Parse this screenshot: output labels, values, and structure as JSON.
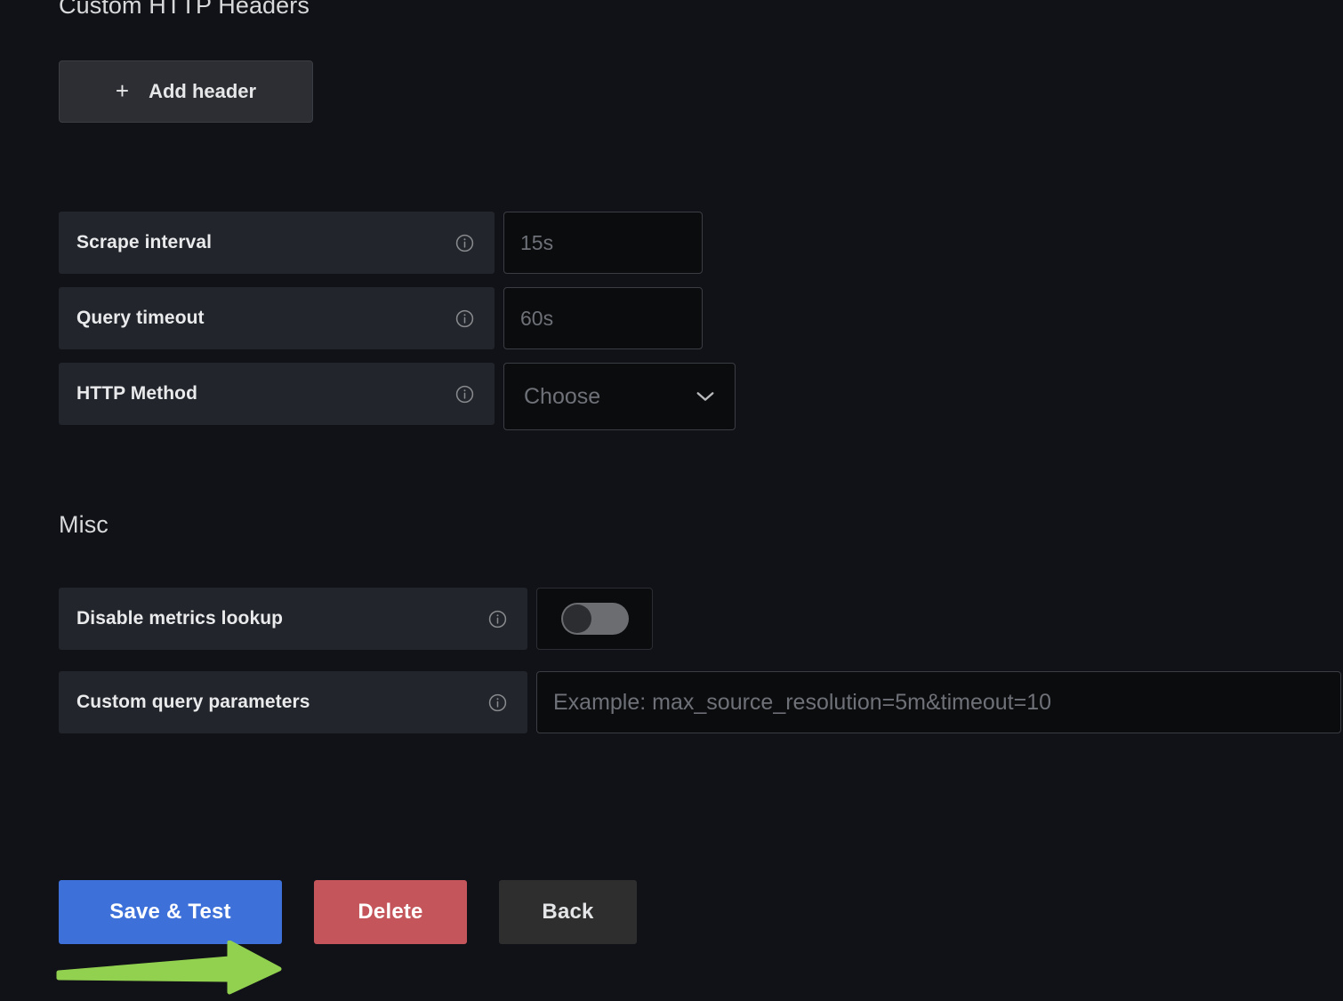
{
  "sections": {
    "http_headers_title": "Custom HTTP Headers",
    "misc_title": "Misc"
  },
  "buttons": {
    "add_header": "Add header",
    "add_header_icon": "plus-icon",
    "save_and_test": "Save & Test",
    "delete": "Delete",
    "back": "Back"
  },
  "fields": {
    "scrape_interval": {
      "label": "Scrape interval",
      "value": "",
      "placeholder": "15s",
      "info_icon": "info-circle-icon"
    },
    "query_timeout": {
      "label": "Query timeout",
      "value": "",
      "placeholder": "60s",
      "info_icon": "info-circle-icon"
    },
    "http_method": {
      "label": "HTTP Method",
      "selected": "Choose",
      "info_icon": "info-circle-icon",
      "chevron_icon": "chevron-down-icon"
    },
    "disable_metrics_lookup": {
      "label": "Disable metrics lookup",
      "info_icon": "info-circle-icon",
      "state": "off"
    },
    "custom_query_parameters": {
      "label": "Custom query parameters",
      "value": "",
      "placeholder": "Example: max_source_resolution=5m&timeout=10",
      "info_icon": "info-circle-icon"
    }
  },
  "annotation": {
    "arrow_icon": "green-arrow-right",
    "color": "#92d14f",
    "points_to": "Save & Test"
  },
  "colors": {
    "page_background": "#111217",
    "label_background": "#22252b",
    "input_background": "#0b0c0e",
    "input_border": "#3a3d44",
    "save_button": "#3d71d9",
    "delete_button": "#c4555a",
    "back_button": "#2e2e2e",
    "toggle_track": "#6b6d70",
    "toggle_knob": "#2b2d30",
    "text_primary": "#d8d9da",
    "placeholder_text": "#6e7178"
  }
}
